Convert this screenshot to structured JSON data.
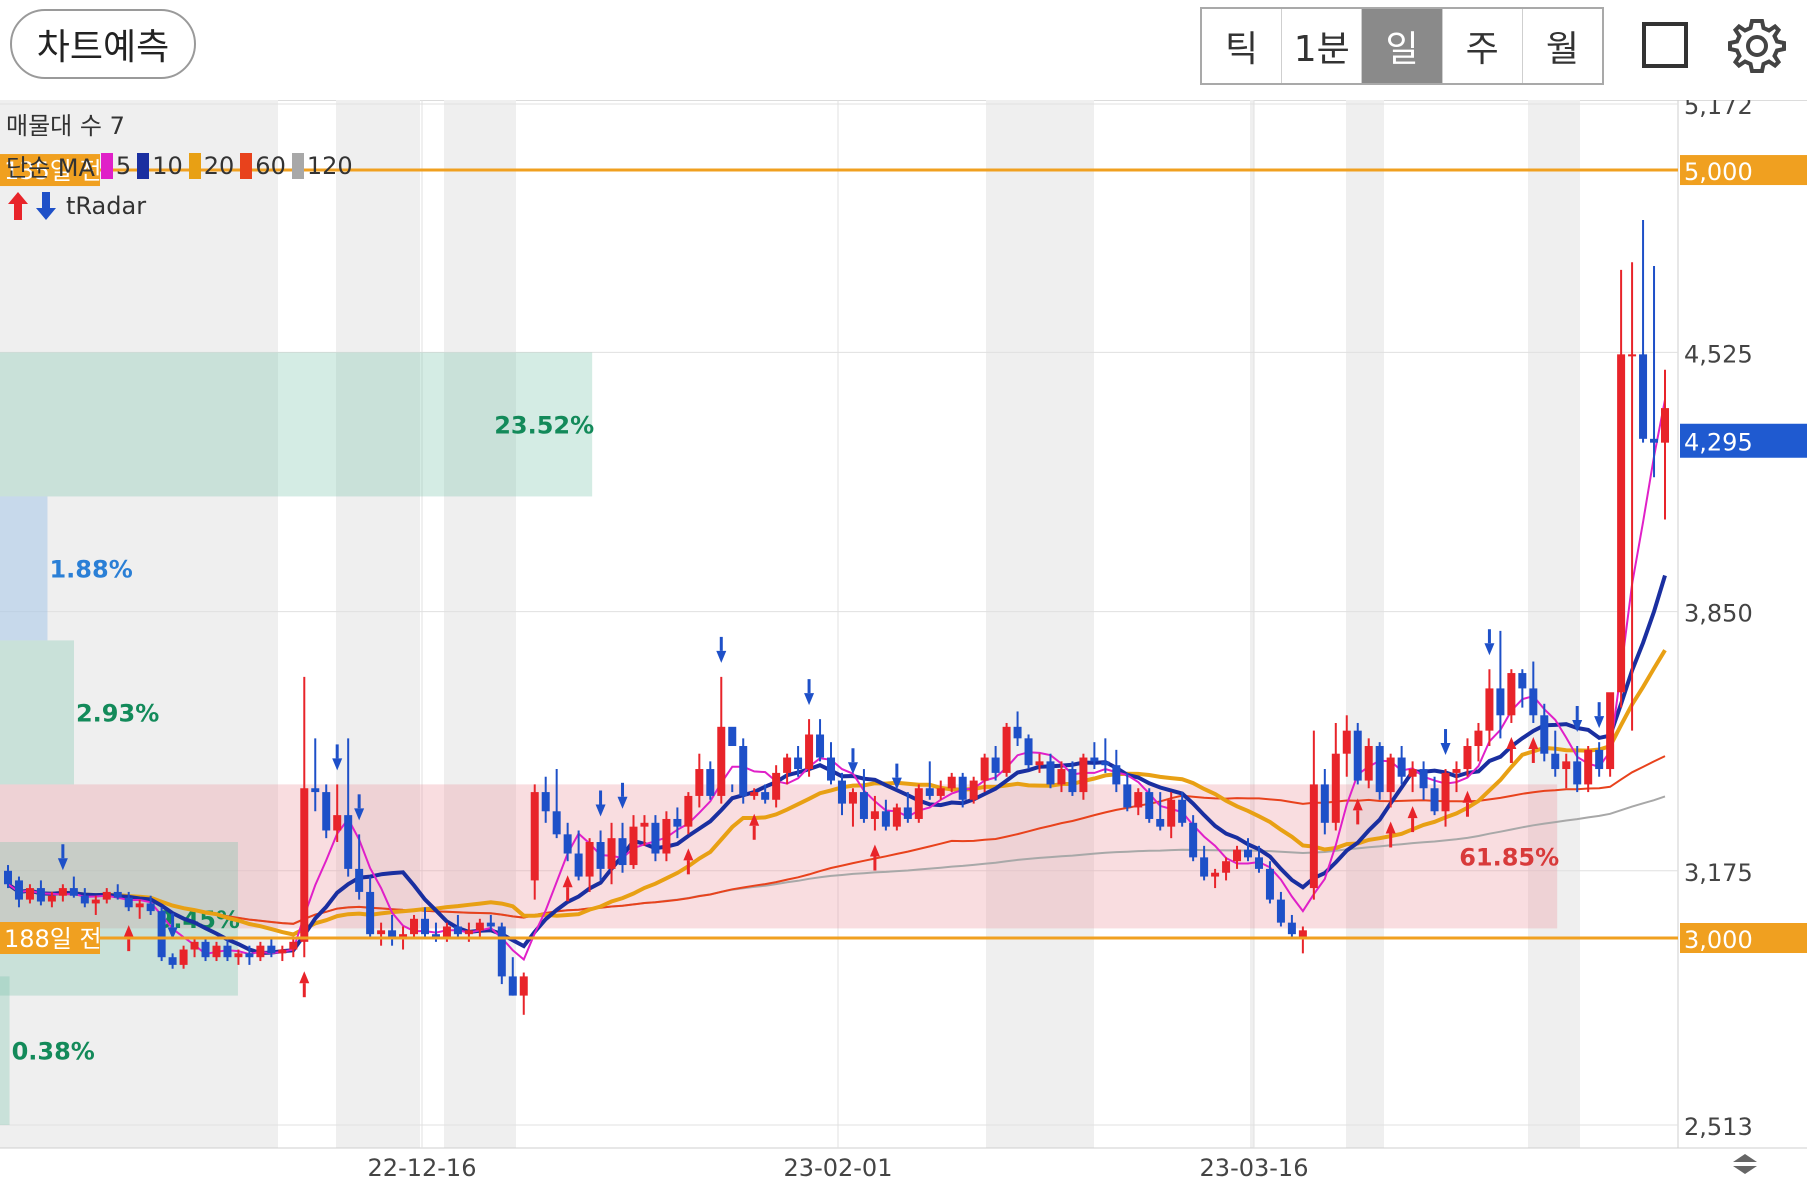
{
  "header": {
    "predict_button": "차트예측",
    "periods": [
      {
        "label": "틱",
        "active": false
      },
      {
        "label": "1분",
        "active": false
      },
      {
        "label": "일",
        "active": true
      },
      {
        "label": "주",
        "active": false
      },
      {
        "label": "월",
        "active": false
      }
    ]
  },
  "legend": {
    "volume_profile": "매물대 수 7",
    "ma_title": "단순 MA",
    "ma_periods": [
      {
        "period": "5",
        "color": "#e020c8"
      },
      {
        "period": "10",
        "color": "#1a2fa0"
      },
      {
        "period": "20",
        "color": "#e8a014"
      },
      {
        "period": "60",
        "color": "#e8421c"
      },
      {
        "period": "120",
        "color": "#a8a8a8"
      }
    ],
    "radar": "tRadar"
  },
  "chart_data": {
    "type": "candlestick",
    "y_axis_ticks": [
      "5,172",
      "4,525",
      "3,850",
      "3,175",
      "2,513"
    ],
    "ylim": [
      2513,
      5172
    ],
    "x_axis_ticks": [
      "22-12-16",
      "23-02-01",
      "23-03-16"
    ],
    "current_price_label": "4,295",
    "level_lines": [
      {
        "label": "5,000",
        "value": 5000,
        "tag": "135일 전",
        "color": "#f0a020"
      },
      {
        "label": "3,000",
        "value": 3000,
        "tag": "188일 전",
        "color": "#f0a020"
      }
    ],
    "volume_profile": [
      {
        "label": "23.52%",
        "low": 4150,
        "high": 4525,
        "fraction": 0.3529
      },
      {
        "label": "1.88%",
        "low": 3775,
        "high": 4150,
        "fraction": 0.0283
      },
      {
        "label": "2.93%",
        "low": 3400,
        "high": 3775,
        "fraction": 0.0441
      },
      {
        "label": "61.85%",
        "low": 3025,
        "high": 3400,
        "fraction": 0.928
      },
      {
        "label": "9.45%",
        "low": 2850,
        "high": 3250,
        "fraction": 0.1418
      },
      {
        "label": "0.38%",
        "low": 2513,
        "high": 2900,
        "fraction": 0.0057
      }
    ],
    "candles": [
      [
        3175,
        3190,
        3130,
        3140
      ],
      [
        3150,
        3160,
        3080,
        3100
      ],
      [
        3100,
        3140,
        3090,
        3130
      ],
      [
        3130,
        3150,
        3085,
        3095
      ],
      [
        3095,
        3120,
        3080,
        3110
      ],
      [
        3110,
        3140,
        3095,
        3130
      ],
      [
        3130,
        3160,
        3105,
        3110
      ],
      [
        3110,
        3130,
        3080,
        3090
      ],
      [
        3090,
        3110,
        3060,
        3100
      ],
      [
        3100,
        3130,
        3090,
        3120
      ],
      [
        3120,
        3140,
        3100,
        3105
      ],
      [
        3105,
        3120,
        3070,
        3080
      ],
      [
        3080,
        3100,
        3050,
        3090
      ],
      [
        3090,
        3110,
        3060,
        3070
      ],
      [
        3070,
        3080,
        2940,
        2950
      ],
      [
        2950,
        2960,
        2920,
        2930
      ],
      [
        2930,
        2980,
        2920,
        2970
      ],
      [
        2970,
        3000,
        2950,
        2990
      ],
      [
        2990,
        3000,
        2940,
        2950
      ],
      [
        2950,
        2990,
        2940,
        2980
      ],
      [
        2980,
        3000,
        2940,
        2950
      ],
      [
        2950,
        2970,
        2930,
        2960
      ],
      [
        2960,
        2980,
        2930,
        2950
      ],
      [
        2950,
        2990,
        2940,
        2980
      ],
      [
        2980,
        3000,
        2950,
        2960
      ],
      [
        2960,
        2980,
        2940,
        2970
      ],
      [
        2970,
        3000,
        2950,
        2990
      ],
      [
        2990,
        3680,
        2950,
        3390
      ],
      [
        3390,
        3520,
        3330,
        3380
      ],
      [
        3380,
        3400,
        3260,
        3280
      ],
      [
        3280,
        3400,
        3250,
        3320
      ],
      [
        3320,
        3520,
        3160,
        3180
      ],
      [
        3180,
        3270,
        3100,
        3120
      ],
      [
        3120,
        3160,
        3000,
        3010
      ],
      [
        3010,
        3040,
        2980,
        3020
      ],
      [
        3020,
        3060,
        2980,
        3000
      ],
      [
        3000,
        3030,
        2970,
        3010
      ],
      [
        3010,
        3060,
        3000,
        3050
      ],
      [
        3050,
        3080,
        3000,
        3010
      ],
      [
        3010,
        3040,
        2990,
        3000
      ],
      [
        3000,
        3040,
        2990,
        3030
      ],
      [
        3030,
        3060,
        3000,
        3010
      ],
      [
        3010,
        3040,
        2990,
        3020
      ],
      [
        3020,
        3050,
        3000,
        3040
      ],
      [
        3040,
        3060,
        3020,
        3030
      ],
      [
        3030,
        3040,
        2880,
        2900
      ],
      [
        2900,
        2950,
        2850,
        2850
      ],
      [
        2850,
        2910,
        2800,
        2900
      ],
      [
        3150,
        3400,
        3100,
        3380
      ],
      [
        3380,
        3420,
        3300,
        3330
      ],
      [
        3330,
        3440,
        3260,
        3270
      ],
      [
        3270,
        3300,
        3200,
        3220
      ],
      [
        3220,
        3280,
        3150,
        3160
      ],
      [
        3160,
        3260,
        3120,
        3250
      ],
      [
        3250,
        3280,
        3150,
        3180
      ],
      [
        3180,
        3300,
        3140,
        3260
      ],
      [
        3260,
        3300,
        3170,
        3190
      ],
      [
        3190,
        3320,
        3180,
        3290
      ],
      [
        3290,
        3320,
        3240,
        3300
      ],
      [
        3300,
        3320,
        3200,
        3220
      ],
      [
        3220,
        3330,
        3200,
        3310
      ],
      [
        3310,
        3340,
        3260,
        3290
      ],
      [
        3290,
        3380,
        3270,
        3370
      ],
      [
        3370,
        3480,
        3340,
        3440
      ],
      [
        3440,
        3460,
        3360,
        3370
      ],
      [
        3370,
        3680,
        3350,
        3550
      ],
      [
        3550,
        3400,
        3380,
        3500
      ],
      [
        3500,
        3520,
        3350,
        3370
      ],
      [
        3370,
        3390,
        3360,
        3380
      ],
      [
        3380,
        3400,
        3350,
        3360
      ],
      [
        3360,
        3450,
        3340,
        3430
      ],
      [
        3430,
        3480,
        3400,
        3470
      ],
      [
        3470,
        3500,
        3420,
        3440
      ],
      [
        3440,
        3570,
        3420,
        3530
      ],
      [
        3530,
        3570,
        3460,
        3470
      ],
      [
        3470,
        3510,
        3400,
        3410
      ],
      [
        3410,
        3430,
        3320,
        3350
      ],
      [
        3350,
        3390,
        3290,
        3380
      ],
      [
        3380,
        3440,
        3300,
        3310
      ],
      [
        3310,
        3370,
        3280,
        3330
      ],
      [
        3330,
        3360,
        3280,
        3290
      ],
      [
        3290,
        3350,
        3280,
        3340
      ],
      [
        3340,
        3380,
        3300,
        3310
      ],
      [
        3310,
        3400,
        3300,
        3390
      ],
      [
        3390,
        3460,
        3360,
        3370
      ],
      [
        3370,
        3410,
        3360,
        3390
      ],
      [
        3390,
        3430,
        3380,
        3420
      ],
      [
        3420,
        3430,
        3340,
        3360
      ],
      [
        3360,
        3420,
        3350,
        3410
      ],
      [
        3410,
        3480,
        3380,
        3470
      ],
      [
        3470,
        3500,
        3410,
        3430
      ],
      [
        3430,
        3560,
        3420,
        3550
      ],
      [
        3550,
        3590,
        3500,
        3520
      ],
      [
        3520,
        3530,
        3440,
        3450
      ],
      [
        3450,
        3480,
        3430,
        3460
      ],
      [
        3460,
        3480,
        3390,
        3400
      ],
      [
        3400,
        3460,
        3380,
        3440
      ],
      [
        3440,
        3460,
        3370,
        3380
      ],
      [
        3380,
        3480,
        3360,
        3470
      ],
      [
        3470,
        3510,
        3440,
        3460
      ],
      [
        3460,
        3520,
        3430,
        3450
      ],
      [
        3450,
        3490,
        3380,
        3400
      ],
      [
        3400,
        3430,
        3330,
        3340
      ],
      [
        3340,
        3390,
        3320,
        3380
      ],
      [
        3380,
        3390,
        3300,
        3310
      ],
      [
        3310,
        3380,
        3280,
        3290
      ],
      [
        3290,
        3380,
        3260,
        3360
      ],
      [
        3360,
        3380,
        3290,
        3300
      ],
      [
        3300,
        3320,
        3200,
        3210
      ],
      [
        3210,
        3240,
        3150,
        3160
      ],
      [
        3160,
        3180,
        3130,
        3170
      ],
      [
        3170,
        3210,
        3150,
        3200
      ],
      [
        3200,
        3240,
        3180,
        3230
      ],
      [
        3230,
        3260,
        3200,
        3210
      ],
      [
        3210,
        3240,
        3170,
        3180
      ],
      [
        3180,
        3200,
        3090,
        3100
      ],
      [
        3100,
        3120,
        3030,
        3040
      ],
      [
        3040,
        3060,
        3000,
        3010
      ],
      [
        3000,
        3030,
        2960,
        3020
      ],
      [
        3130,
        3540,
        3100,
        3400
      ],
      [
        3400,
        3440,
        3270,
        3300
      ],
      [
        3300,
        3560,
        3280,
        3480
      ],
      [
        3480,
        3580,
        3420,
        3540
      ],
      [
        3540,
        3560,
        3400,
        3410
      ],
      [
        3410,
        3520,
        3390,
        3500
      ],
      [
        3500,
        3510,
        3360,
        3380
      ],
      [
        3380,
        3480,
        3340,
        3470
      ],
      [
        3470,
        3500,
        3400,
        3420
      ],
      [
        3420,
        3460,
        3380,
        3440
      ],
      [
        3440,
        3460,
        3360,
        3390
      ],
      [
        3390,
        3420,
        3320,
        3330
      ],
      [
        3330,
        3440,
        3290,
        3430
      ],
      [
        3430,
        3460,
        3380,
        3440
      ],
      [
        3440,
        3520,
        3420,
        3500
      ],
      [
        3500,
        3560,
        3460,
        3540
      ],
      [
        3540,
        3700,
        3500,
        3650
      ],
      [
        3650,
        3800,
        3520,
        3580
      ],
      [
        3580,
        3700,
        3560,
        3690
      ],
      [
        3690,
        3700,
        3600,
        3650
      ],
      [
        3650,
        3720,
        3560,
        3580
      ],
      [
        3580,
        3610,
        3460,
        3480
      ],
      [
        3480,
        3540,
        3420,
        3440
      ],
      [
        3440,
        3480,
        3390,
        3460
      ],
      [
        3460,
        3500,
        3380,
        3400
      ],
      [
        3400,
        3500,
        3380,
        3490
      ],
      [
        3490,
        3510,
        3420,
        3440
      ],
      [
        3440,
        3560,
        3420,
        3640
      ],
      [
        3640,
        4740,
        3600,
        4520
      ],
      [
        4520,
        4760,
        3540,
        4520
      ],
      [
        4520,
        4870,
        4290,
        4300
      ],
      [
        4300,
        4750,
        4200,
        4290
      ],
      [
        4290,
        4480,
        4090,
        4380
      ]
    ]
  }
}
